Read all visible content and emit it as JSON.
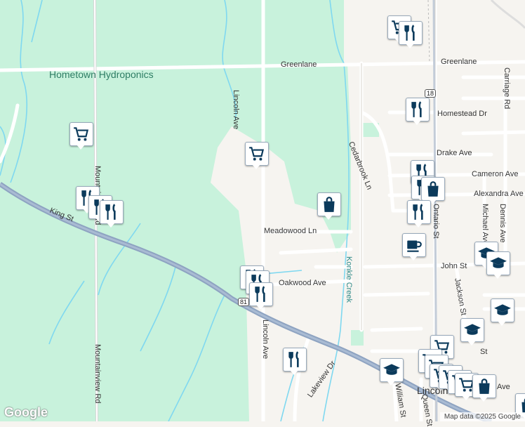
{
  "colors": {
    "park": "#c8f2dc",
    "road": "#ffffff",
    "highway": "#8ea3c1",
    "water": "#7fd8f0",
    "pin": "#0b3a5b"
  },
  "labels": {
    "hometown": "Hometown Hydroponics",
    "greenlane_w": "Greenlane",
    "greenlane_e": "Greenlane",
    "lincoln_n": "Lincoln Ave",
    "lincoln_s": "Lincoln Ave",
    "mountainview_n": "Mountainview Rd",
    "mountainview_s": "Mountainview Rd",
    "king": "King St",
    "cedarbrook": "Cedarbrook Ln",
    "homestead": "Homestead Dr",
    "drake": "Drake Ave",
    "cameron": "Cameron Ave",
    "alexandra": "Alexandra Ave",
    "meadowood": "Meadowood Ln",
    "oakwood": "Oakwood Ave",
    "john": "John St",
    "konkle": "Konkle Creek",
    "ontario": "Ontario St",
    "michael": "Michael Ave",
    "dennis": "Dennis Ave",
    "carriage": "Carriage Rd",
    "jackson": "Jackson St",
    "lakeview": "Lakeview Dr",
    "william": "William St",
    "queen": "Queen St",
    "lincoln_town": "Lincoln",
    "st_small": "St",
    "ave_small": "Ave",
    "route18": "18",
    "route81": "81"
  },
  "footer": {
    "attribution": "Map data ©2025 Google",
    "logo": "Google"
  },
  "pois": [
    {
      "type": "grocery-icon"
    },
    {
      "type": "restaurant-icon"
    },
    {
      "type": "restaurant-icon"
    },
    {
      "type": "grocery-icon"
    },
    {
      "type": "restaurant-icon"
    },
    {
      "type": "restaurant-icon"
    },
    {
      "type": "grocery-icon"
    },
    {
      "type": "restaurant-icon"
    },
    {
      "type": "shopping-bag-icon"
    },
    {
      "type": "restaurant-icon"
    },
    {
      "type": "restaurant-icon"
    },
    {
      "type": "shopping-bag-icon"
    },
    {
      "type": "cafe-icon"
    },
    {
      "type": "school-icon"
    },
    {
      "type": "school-icon"
    },
    {
      "type": "restaurant-icon"
    },
    {
      "type": "restaurant-icon"
    },
    {
      "type": "school-icon"
    },
    {
      "type": "school-icon"
    },
    {
      "type": "restaurant-icon"
    },
    {
      "type": "school-icon"
    },
    {
      "type": "grocery-icon"
    },
    {
      "type": "grocery-icon"
    },
    {
      "type": "grocery-icon"
    },
    {
      "type": "shopping-bag-icon"
    }
  ]
}
